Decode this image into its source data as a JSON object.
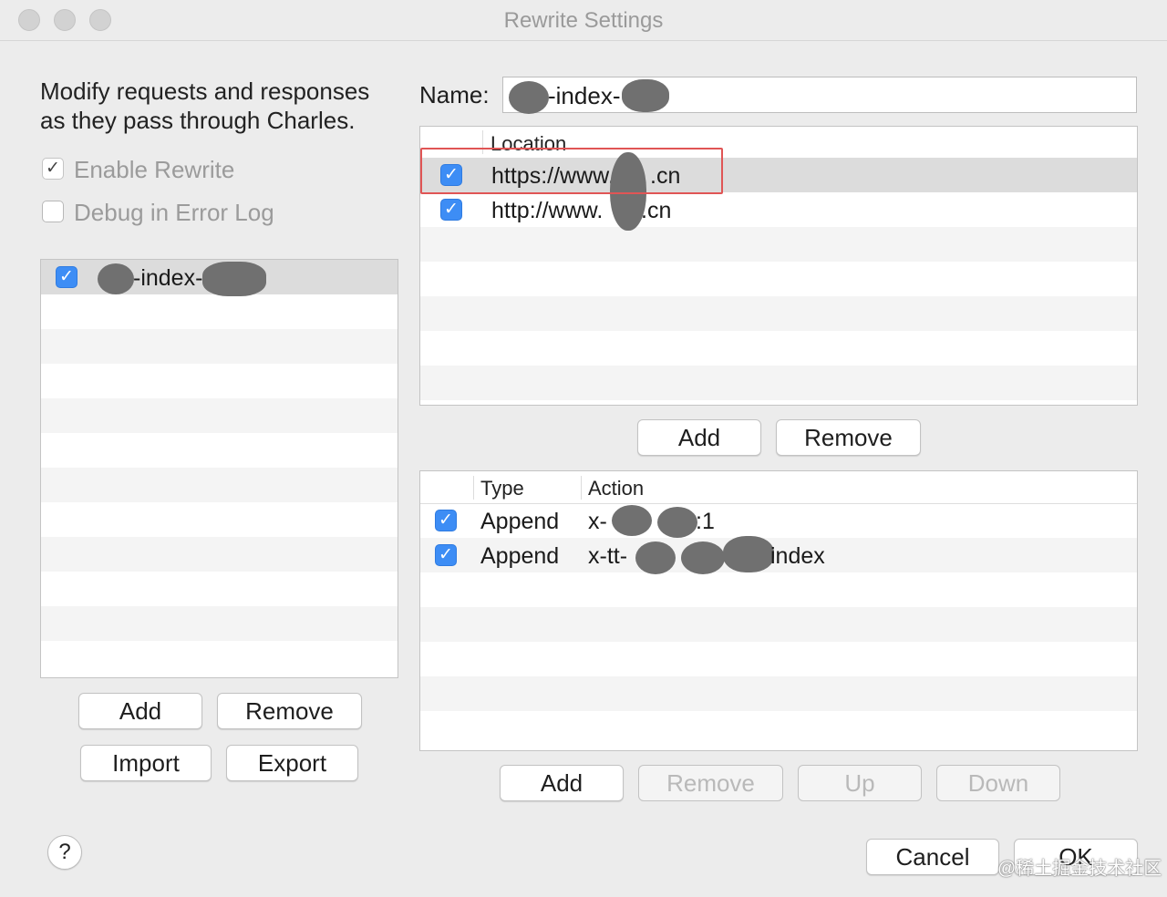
{
  "window": {
    "title": "Rewrite Settings"
  },
  "left": {
    "description_line1": "Modify requests and responses",
    "description_line2": "as they pass through Charles.",
    "enable_rewrite": {
      "label": "Enable Rewrite",
      "checked": true
    },
    "debug_in_error_log": {
      "label": "Debug in Error Log",
      "checked": false
    },
    "sets": [
      {
        "name": "-index-",
        "checked": true,
        "selected": true
      }
    ],
    "buttons": {
      "add": "Add",
      "remove": "Remove",
      "import": "Import",
      "export": "Export"
    }
  },
  "name_field": {
    "label": "Name:",
    "value": "-index-"
  },
  "locations": {
    "header": "Location",
    "rows": [
      {
        "checked": true,
        "prefix": "https://www.",
        "suffix": ".cn",
        "selected": true
      },
      {
        "checked": true,
        "prefix": "http://www.",
        "suffix": ".cn",
        "selected": false
      }
    ],
    "buttons": {
      "add": "Add",
      "remove": "Remove"
    }
  },
  "rules": {
    "headers": {
      "type": "Type",
      "action": "Action"
    },
    "rows": [
      {
        "checked": true,
        "type": "Append",
        "action_prefix": "x-",
        "action_suffix": ":1"
      },
      {
        "checked": true,
        "type": "Append",
        "action_prefix": "x-tt-",
        "action_suffix": "index"
      }
    ],
    "buttons": {
      "add": "Add",
      "remove": "Remove",
      "up": "Up",
      "down": "Down"
    }
  },
  "footer": {
    "help": "?",
    "cancel": "Cancel",
    "ok": "OK",
    "watermark": "@稀土掘金技术社区"
  },
  "colors": {
    "checkbox_blue": "#3d8df5",
    "highlight_red": "#e05555",
    "window_bg": "#ececec"
  }
}
